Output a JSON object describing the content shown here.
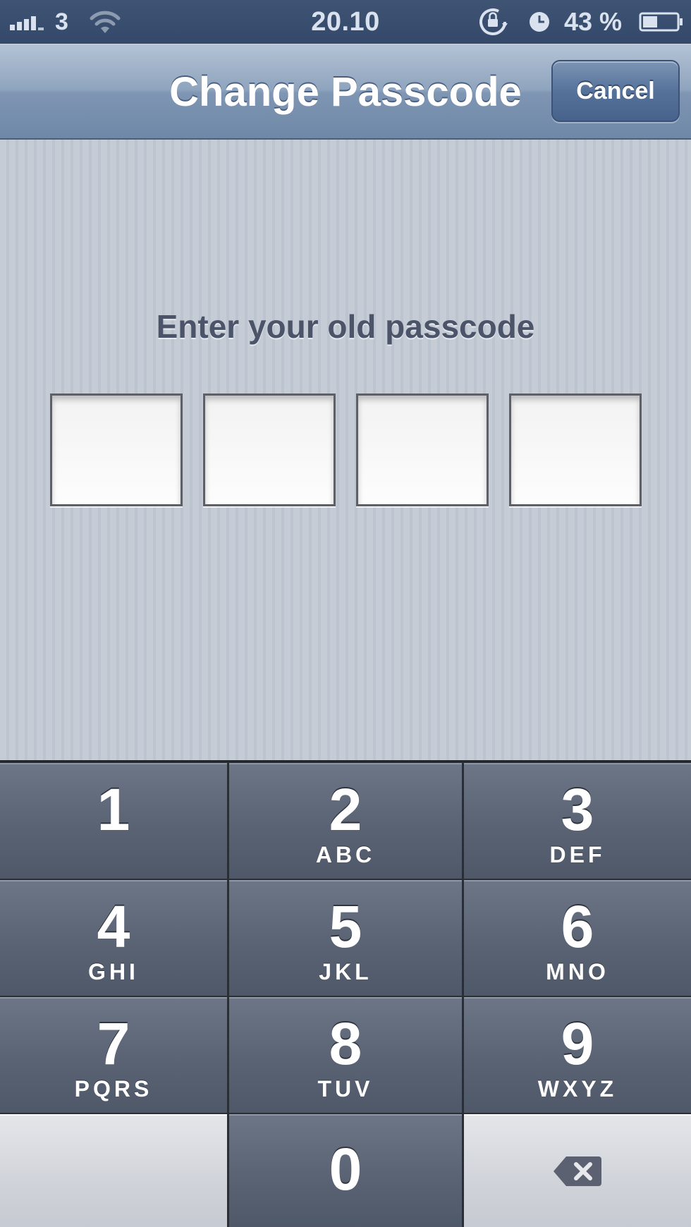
{
  "status_bar": {
    "carrier": "3",
    "time": "20.10",
    "battery_percent": "43 %",
    "battery_level": 0.43,
    "icons": [
      "signal-icon",
      "wifi-icon",
      "rotation-lock-icon",
      "alarm-icon",
      "battery-icon"
    ]
  },
  "nav": {
    "title": "Change Passcode",
    "cancel_label": "Cancel"
  },
  "content": {
    "prompt": "Enter your old passcode",
    "passcode_length": 4
  },
  "keypad": {
    "keys": [
      {
        "digit": "1",
        "letters": ""
      },
      {
        "digit": "2",
        "letters": "ABC"
      },
      {
        "digit": "3",
        "letters": "DEF"
      },
      {
        "digit": "4",
        "letters": "GHI"
      },
      {
        "digit": "5",
        "letters": "JKL"
      },
      {
        "digit": "6",
        "letters": "MNO"
      },
      {
        "digit": "7",
        "letters": "PQRS"
      },
      {
        "digit": "8",
        "letters": "TUV"
      },
      {
        "digit": "9",
        "letters": "WXYZ"
      },
      {
        "digit": "0",
        "letters": ""
      }
    ],
    "delete_icon": "backspace-icon"
  },
  "colors": {
    "status_bar": "#3f5473",
    "nav_bar": "#8fa4be",
    "content_bg": "#c5ccd6",
    "key_dark": "#5a6374",
    "key_light": "#d0d3d9",
    "prompt_text": "#4b5468"
  }
}
